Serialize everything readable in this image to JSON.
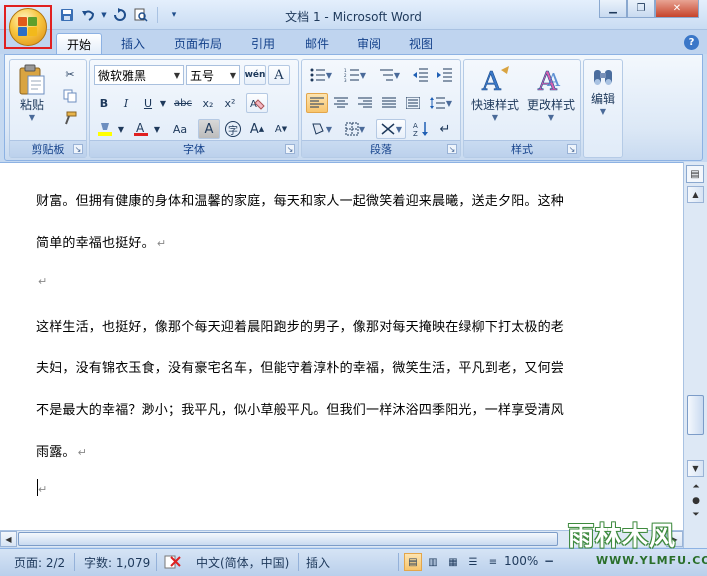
{
  "window": {
    "title": "文档 1 - Microsoft Word",
    "controls": {
      "minimize": "▁",
      "restore": "❐",
      "close": "✕"
    }
  },
  "quick_access": {
    "icons": [
      "save-icon",
      "undo-icon",
      "redo-icon",
      "print-preview-icon",
      "customize-qat-icon"
    ]
  },
  "tabs": [
    {
      "label": "开始",
      "active": true
    },
    {
      "label": "插入",
      "active": false
    },
    {
      "label": "页面布局",
      "active": false
    },
    {
      "label": "引用",
      "active": false
    },
    {
      "label": "邮件",
      "active": false
    },
    {
      "label": "审阅",
      "active": false
    },
    {
      "label": "视图",
      "active": false
    }
  ],
  "ribbon": {
    "clipboard": {
      "label": "剪贴板",
      "paste_label": "粘贴"
    },
    "font": {
      "label": "字体",
      "font_name": "微软雅黑",
      "font_size": "五号",
      "bold": "B",
      "italic": "I",
      "underline": "U",
      "strike": "abc",
      "subscript": "x₂",
      "superscript": "x²",
      "clear_format": "A",
      "phonetic": "wén",
      "change_case": "Aa",
      "char_shading": "A",
      "enclose": "字",
      "grow": "A",
      "shrink": "A"
    },
    "paragraph": {
      "label": "段落"
    },
    "styles": {
      "label": "样式",
      "quick_styles": "快速样式",
      "change_styles": "更改样式"
    },
    "editing": {
      "label": "编辑"
    }
  },
  "document": {
    "paragraphs": [
      {
        "text": "财富。但拥有健康的身体和温馨的家庭，每天和家人一起微笑着迎来晨曦，送走夕阳。这种",
        "mark": ""
      },
      {
        "text": "简单的幸福也挺好。",
        "mark": "↵"
      },
      {
        "text": "",
        "mark": "↵"
      },
      {
        "text": "这样生活，也挺好，像那个每天迎着晨阳跑步的男子，像那对每天掩映在绿柳下打太极的老",
        "mark": ""
      },
      {
        "text": "夫妇，没有锦衣玉食，没有豪宅名车，但能守着淳朴的幸福，微笑生活，平凡到老，又何尝",
        "mark": ""
      },
      {
        "text": "不是最大的幸福？渺小；我平凡，似小草般平凡。但我们一样沐浴四季阳光，一样享受清风",
        "mark": ""
      },
      {
        "text": "雨露。",
        "mark": "↵"
      },
      {
        "text": "",
        "mark": "↵"
      }
    ]
  },
  "status_bar": {
    "page": "页面: 2/2",
    "words": "字数: 1,079",
    "language": "中文(简体，中国)",
    "insert_mode": "插入",
    "zoom": "100%"
  },
  "watermark": {
    "title": "雨林木风",
    "url": "WWW.YLMFU.COM"
  }
}
